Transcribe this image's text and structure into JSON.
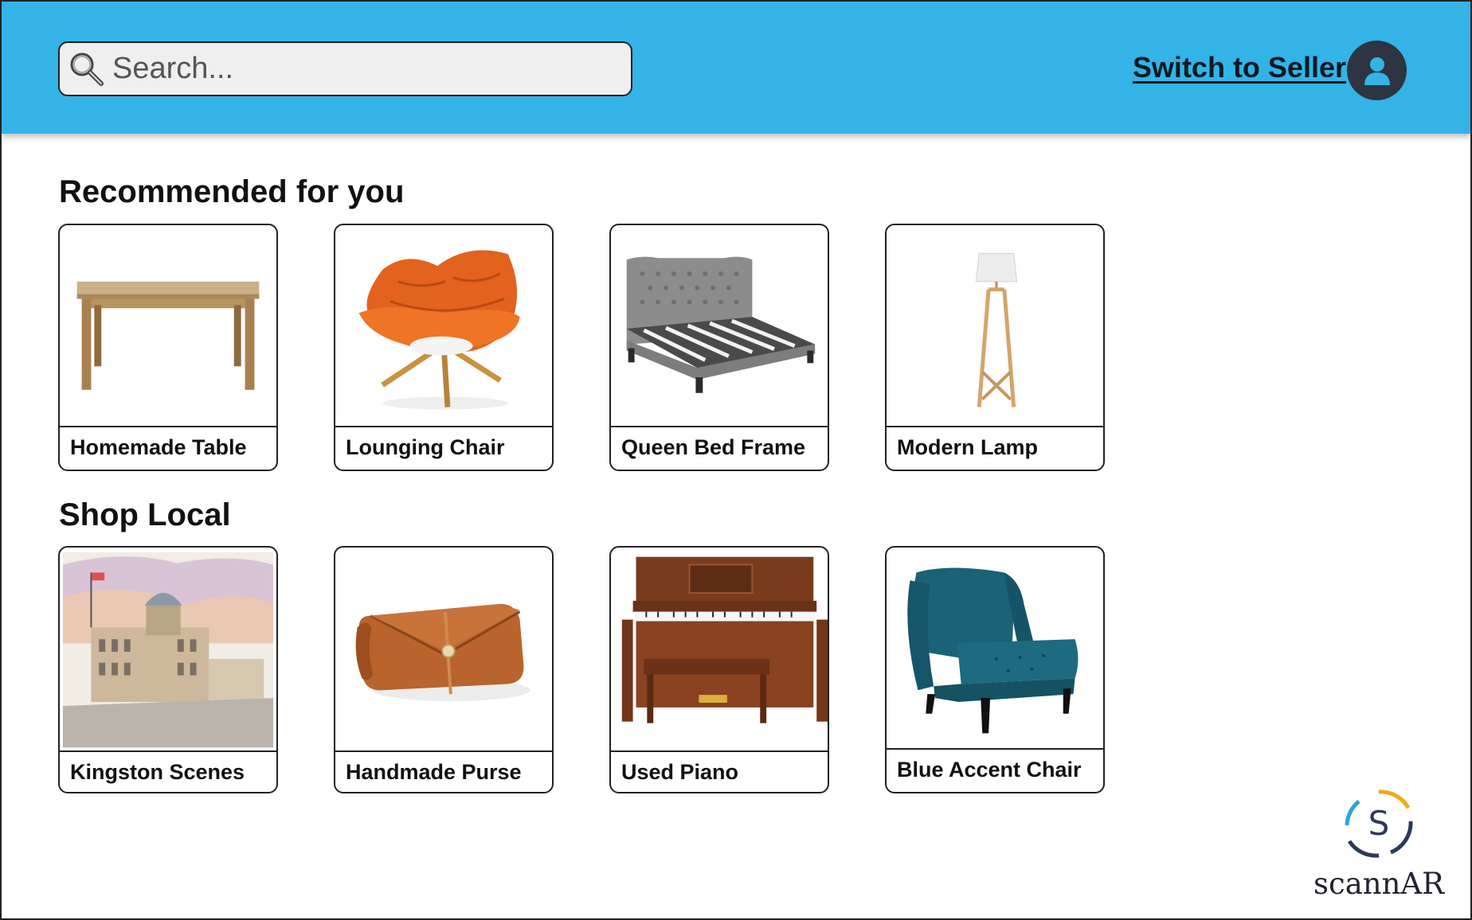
{
  "header": {
    "search_placeholder": "Search...",
    "switch_label": "Switch to Seller",
    "bar_color": "#33b3e6"
  },
  "sections": {
    "recommended": {
      "title": "Recommended for you",
      "items": [
        {
          "label": "Homemade Table",
          "icon": "table-image"
        },
        {
          "label": "Lounging Chair",
          "icon": "orange-chair-image"
        },
        {
          "label": "Queen Bed Frame",
          "icon": "bed-frame-image"
        },
        {
          "label": "Modern Lamp",
          "icon": "floor-lamp-image"
        }
      ]
    },
    "local": {
      "title": "Shop Local",
      "items": [
        {
          "label": "Kingston Scenes",
          "icon": "painting-image"
        },
        {
          "label": "Handmade Purse",
          "icon": "purse-image"
        },
        {
          "label": "Used Piano",
          "icon": "piano-image"
        },
        {
          "label": "Blue Accent Chair",
          "icon": "blue-chair-image"
        }
      ]
    }
  },
  "brand": {
    "name": "scannAR",
    "letter": "S"
  }
}
